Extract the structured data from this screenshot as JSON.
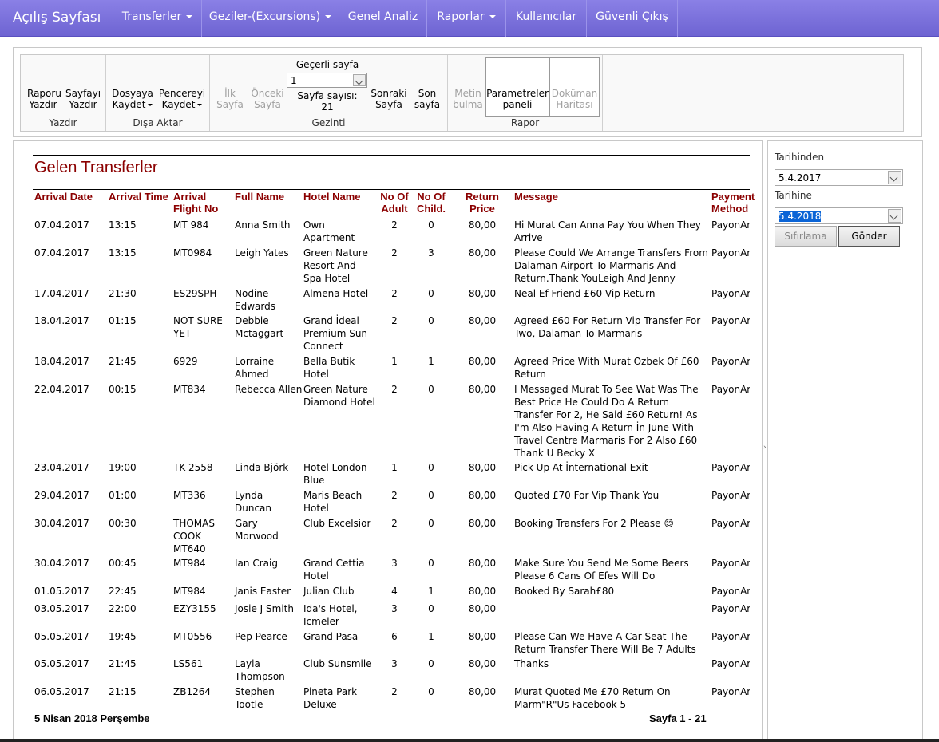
{
  "nav": {
    "brand": "Açılış Sayfası",
    "items": [
      {
        "label": "Transferler",
        "dropdown": true
      },
      {
        "label": "Geziler-(Excursions)",
        "dropdown": true
      },
      {
        "label": "Genel Analiz",
        "dropdown": false
      },
      {
        "label": "Raporlar",
        "dropdown": true
      },
      {
        "label": "Kullanıcılar",
        "dropdown": false
      },
      {
        "label": "Güvenli Çıkış",
        "dropdown": false
      }
    ]
  },
  "toolbar": {
    "print_group": "Yazdır",
    "print_report": "Raporu\nYazdır",
    "print_page": "Sayfayı\nYazdır",
    "export_group": "Dışa Aktar",
    "save_file": "Dosyaya\nKaydet",
    "save_window": "Pencereyi\nKaydet",
    "nav_group": "Gezinti",
    "first_page": "İlk\nSayfa",
    "prev_page": "Önceki\nSayfa",
    "current_page_label": "Geçerli sayfa",
    "current_page_value": "1",
    "page_count": "Sayfa sayısı: 21",
    "next_page": "Sonraki\nSayfa",
    "last_page": "Son\nsayfa",
    "report_group": "Rapor",
    "find_text": "Metin\nbulma",
    "params_panel": "Parametreler\npaneli",
    "doc_map": "Doküman\nHaritası"
  },
  "report": {
    "title": "Gelen Transferler",
    "columns": [
      "Arrival Date",
      "Arrival Time",
      "Arrival\nFlight No",
      "Full Name",
      "Hotel Name",
      "No Of\nAdult",
      "No Of\nChild.",
      "Return\nPrice",
      "Message",
      "Payment\nMethod"
    ],
    "rows": [
      {
        "date": "07.04.2017",
        "time": "13:15",
        "flight": "MT 984",
        "name": "Anna Smith",
        "hotel": "Own\nApartment",
        "adult": "2",
        "child": "0",
        "price": "80,00",
        "message": "Hi Murat Can Anna Pay You When They\nArrive",
        "payment": "PayonAr"
      },
      {
        "date": "07.04.2017",
        "time": "13:15",
        "flight": "MT0984",
        "name": "Leigh Yates",
        "hotel": "Green Nature\nResort And\nSpa Hotel",
        "adult": "2",
        "child": "3",
        "price": "80,00",
        "message": "Please Could We Arrange Transfers From\nDalaman Airport To Marmaris And\nReturn.Thank YouLeigh And Jenny",
        "payment": "PayonAr"
      },
      {
        "date": "17.04.2017",
        "time": "21:30",
        "flight": "ES29SPH",
        "name": "Nodine\nEdwards",
        "hotel": "Almena Hotel",
        "adult": "2",
        "child": "0",
        "price": "80,00",
        "message": "Neal Ef Friend £60 Vip Return",
        "payment": "PayonAr"
      },
      {
        "date": "18.04.2017",
        "time": "01:15",
        "flight": "NOT SURE\nYET",
        "name": "Debbie\nMctaggart",
        "hotel": "Grand İdeal\nPremium Sun\nConnect",
        "adult": "2",
        "child": "0",
        "price": "80,00",
        "message": "Agreed £60 For Return Vip Transfer For\nTwo, Dalaman To Marmaris",
        "payment": "PayonAr"
      },
      {
        "date": "18.04.2017",
        "time": "21:45",
        "flight": "6929",
        "name": "Lorraine\nAhmed",
        "hotel": "Bella Butik\nHotel",
        "adult": "1",
        "child": "1",
        "price": "80,00",
        "message": "Agreed Price With Murat Ozbek Of £60\nReturn",
        "payment": "PayonAr"
      },
      {
        "date": "22.04.2017",
        "time": "00:15",
        "flight": "MT834",
        "name": "Rebecca Allen",
        "hotel": "Green Nature\nDiamond Hotel",
        "adult": "2",
        "child": "0",
        "price": "80,00",
        "message": "I Messaged Murat To See Wat Was The\nBest Price He Could Do A Return\nTransfer For 2, He Said £60 Return! As\nI'm Also Having A Return İn June With\nTravel Centre Marmaris For 2 Also £60\nThank U Becky X",
        "payment": "PayonAr"
      },
      {
        "date": "23.04.2017",
        "time": "19:00",
        "flight": "TK 2558",
        "name": "Linda Björk",
        "hotel": "Hotel London\nBlue",
        "adult": "1",
        "child": "0",
        "price": "80,00",
        "message": "Pick Up At İnternational Exit",
        "payment": "PayonAr"
      },
      {
        "date": "29.04.2017",
        "time": "01:00",
        "flight": "MT336",
        "name": "Lynda\nDuncan",
        "hotel": "Maris Beach\nHotel",
        "adult": "2",
        "child": "0",
        "price": "80,00",
        "message": "Quoted £70 For Vip Thank You",
        "payment": "PayonAr"
      },
      {
        "date": "30.04.2017",
        "time": "00:30",
        "flight": "THOMAS\nCOOK\nMT640",
        "name": "Gary\nMorwood",
        "hotel": "Club Excelsior",
        "adult": "2",
        "child": "0",
        "price": "80,00",
        "message": "Booking Transfers For 2 Please 😊",
        "payment": "PayonAr"
      },
      {
        "date": "30.04.2017",
        "time": "00:45",
        "flight": "MT984",
        "name": "Ian Craig",
        "hotel": "Grand Cettia\nHotel",
        "adult": "3",
        "child": "0",
        "price": "80,00",
        "message": "Make Sure You Send Me Some Beers\nPlease 6 Cans Of Efes Will Do",
        "payment": "PayonAr"
      },
      {
        "date": "01.05.2017",
        "time": "22:45",
        "flight": "MT984",
        "name": "Janis Easter",
        "hotel": "Julian Club",
        "adult": "4",
        "child": "1",
        "price": "80,00",
        "message": "Booked By Sarah£80",
        "payment": "PayonAr"
      },
      {
        "date": "03.05.2017",
        "time": "22:00",
        "flight": "EZY3155",
        "name": "Josie J Smith",
        "hotel": "Ida's Hotel,\nIcmeler",
        "adult": "3",
        "child": "0",
        "price": "80,00",
        "message": "",
        "payment": "PayonAr"
      },
      {
        "date": "05.05.2017",
        "time": "19:45",
        "flight": "MT0556",
        "name": "Pep Pearce",
        "hotel": "Grand Pasa",
        "adult": "6",
        "child": "1",
        "price": "80,00",
        "message": "Please Can We Have A Car Seat The\nReturn Transfer There Will Be 7 Adults",
        "payment": "PayonAr"
      },
      {
        "date": "05.05.2017",
        "time": "21:45",
        "flight": "LS561",
        "name": "Layla\nThompson",
        "hotel": "Club Sunsmile",
        "adult": "3",
        "child": "0",
        "price": "80,00",
        "message": "Thanks",
        "payment": "PayonAr"
      },
      {
        "date": "06.05.2017",
        "time": "21:15",
        "flight": "ZB1264",
        "name": "Stephen\nTootle",
        "hotel": "Pineta Park\nDeluxe",
        "adult": "2",
        "child": "0",
        "price": "80,00",
        "message": "Murat Quoted Me £70 Return On\nMarm\"R\"Us Facebook 5",
        "payment": "PayonAr"
      }
    ],
    "footer_date": "5 Nisan 2018 Perşembe",
    "footer_page": "Sayfa 1 - 21"
  },
  "params": {
    "from_label": "Tarihinden",
    "from_value": "5.4.2017",
    "to_label": "Tarihine",
    "to_value": "5.4.2018",
    "reset_label": "Sıfırlama",
    "submit_label": "Gönder"
  },
  "colors": {
    "nav_bg": "#7a70de",
    "report_header": "#8b0000",
    "selection": "#0a64d6"
  }
}
